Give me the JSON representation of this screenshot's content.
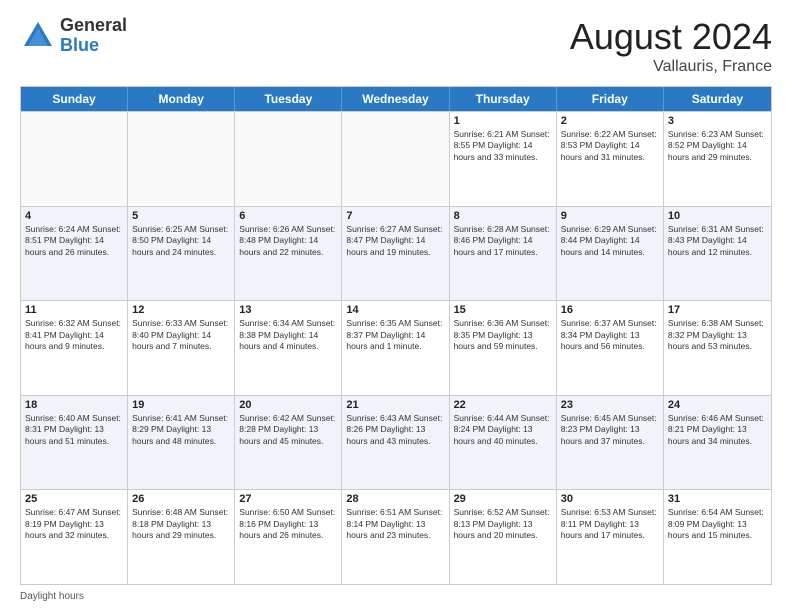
{
  "header": {
    "logo_general": "General",
    "logo_blue": "Blue",
    "month_title": "August 2024",
    "location": "Vallauris, France"
  },
  "weekdays": [
    "Sunday",
    "Monday",
    "Tuesday",
    "Wednesday",
    "Thursday",
    "Friday",
    "Saturday"
  ],
  "footer": {
    "daylight_label": "Daylight hours"
  },
  "weeks": [
    [
      {
        "day": "",
        "info": "",
        "empty": true
      },
      {
        "day": "",
        "info": "",
        "empty": true
      },
      {
        "day": "",
        "info": "",
        "empty": true
      },
      {
        "day": "",
        "info": "",
        "empty": true
      },
      {
        "day": "1",
        "info": "Sunrise: 6:21 AM\nSunset: 8:55 PM\nDaylight: 14 hours\nand 33 minutes."
      },
      {
        "day": "2",
        "info": "Sunrise: 6:22 AM\nSunset: 8:53 PM\nDaylight: 14 hours\nand 31 minutes."
      },
      {
        "day": "3",
        "info": "Sunrise: 6:23 AM\nSunset: 8:52 PM\nDaylight: 14 hours\nand 29 minutes."
      }
    ],
    [
      {
        "day": "4",
        "info": "Sunrise: 6:24 AM\nSunset: 8:51 PM\nDaylight: 14 hours\nand 26 minutes."
      },
      {
        "day": "5",
        "info": "Sunrise: 6:25 AM\nSunset: 8:50 PM\nDaylight: 14 hours\nand 24 minutes."
      },
      {
        "day": "6",
        "info": "Sunrise: 6:26 AM\nSunset: 8:48 PM\nDaylight: 14 hours\nand 22 minutes."
      },
      {
        "day": "7",
        "info": "Sunrise: 6:27 AM\nSunset: 8:47 PM\nDaylight: 14 hours\nand 19 minutes."
      },
      {
        "day": "8",
        "info": "Sunrise: 6:28 AM\nSunset: 8:46 PM\nDaylight: 14 hours\nand 17 minutes."
      },
      {
        "day": "9",
        "info": "Sunrise: 6:29 AM\nSunset: 8:44 PM\nDaylight: 14 hours\nand 14 minutes."
      },
      {
        "day": "10",
        "info": "Sunrise: 6:31 AM\nSunset: 8:43 PM\nDaylight: 14 hours\nand 12 minutes."
      }
    ],
    [
      {
        "day": "11",
        "info": "Sunrise: 6:32 AM\nSunset: 8:41 PM\nDaylight: 14 hours\nand 9 minutes."
      },
      {
        "day": "12",
        "info": "Sunrise: 6:33 AM\nSunset: 8:40 PM\nDaylight: 14 hours\nand 7 minutes."
      },
      {
        "day": "13",
        "info": "Sunrise: 6:34 AM\nSunset: 8:38 PM\nDaylight: 14 hours\nand 4 minutes."
      },
      {
        "day": "14",
        "info": "Sunrise: 6:35 AM\nSunset: 8:37 PM\nDaylight: 14 hours\nand 1 minute."
      },
      {
        "day": "15",
        "info": "Sunrise: 6:36 AM\nSunset: 8:35 PM\nDaylight: 13 hours\nand 59 minutes."
      },
      {
        "day": "16",
        "info": "Sunrise: 6:37 AM\nSunset: 8:34 PM\nDaylight: 13 hours\nand 56 minutes."
      },
      {
        "day": "17",
        "info": "Sunrise: 6:38 AM\nSunset: 8:32 PM\nDaylight: 13 hours\nand 53 minutes."
      }
    ],
    [
      {
        "day": "18",
        "info": "Sunrise: 6:40 AM\nSunset: 8:31 PM\nDaylight: 13 hours\nand 51 minutes."
      },
      {
        "day": "19",
        "info": "Sunrise: 6:41 AM\nSunset: 8:29 PM\nDaylight: 13 hours\nand 48 minutes."
      },
      {
        "day": "20",
        "info": "Sunrise: 6:42 AM\nSunset: 8:28 PM\nDaylight: 13 hours\nand 45 minutes."
      },
      {
        "day": "21",
        "info": "Sunrise: 6:43 AM\nSunset: 8:26 PM\nDaylight: 13 hours\nand 43 minutes."
      },
      {
        "day": "22",
        "info": "Sunrise: 6:44 AM\nSunset: 8:24 PM\nDaylight: 13 hours\nand 40 minutes."
      },
      {
        "day": "23",
        "info": "Sunrise: 6:45 AM\nSunset: 8:23 PM\nDaylight: 13 hours\nand 37 minutes."
      },
      {
        "day": "24",
        "info": "Sunrise: 6:46 AM\nSunset: 8:21 PM\nDaylight: 13 hours\nand 34 minutes."
      }
    ],
    [
      {
        "day": "25",
        "info": "Sunrise: 6:47 AM\nSunset: 8:19 PM\nDaylight: 13 hours\nand 32 minutes."
      },
      {
        "day": "26",
        "info": "Sunrise: 6:48 AM\nSunset: 8:18 PM\nDaylight: 13 hours\nand 29 minutes."
      },
      {
        "day": "27",
        "info": "Sunrise: 6:50 AM\nSunset: 8:16 PM\nDaylight: 13 hours\nand 26 minutes."
      },
      {
        "day": "28",
        "info": "Sunrise: 6:51 AM\nSunset: 8:14 PM\nDaylight: 13 hours\nand 23 minutes."
      },
      {
        "day": "29",
        "info": "Sunrise: 6:52 AM\nSunset: 8:13 PM\nDaylight: 13 hours\nand 20 minutes."
      },
      {
        "day": "30",
        "info": "Sunrise: 6:53 AM\nSunset: 8:11 PM\nDaylight: 13 hours\nand 17 minutes."
      },
      {
        "day": "31",
        "info": "Sunrise: 6:54 AM\nSunset: 8:09 PM\nDaylight: 13 hours\nand 15 minutes."
      }
    ]
  ]
}
